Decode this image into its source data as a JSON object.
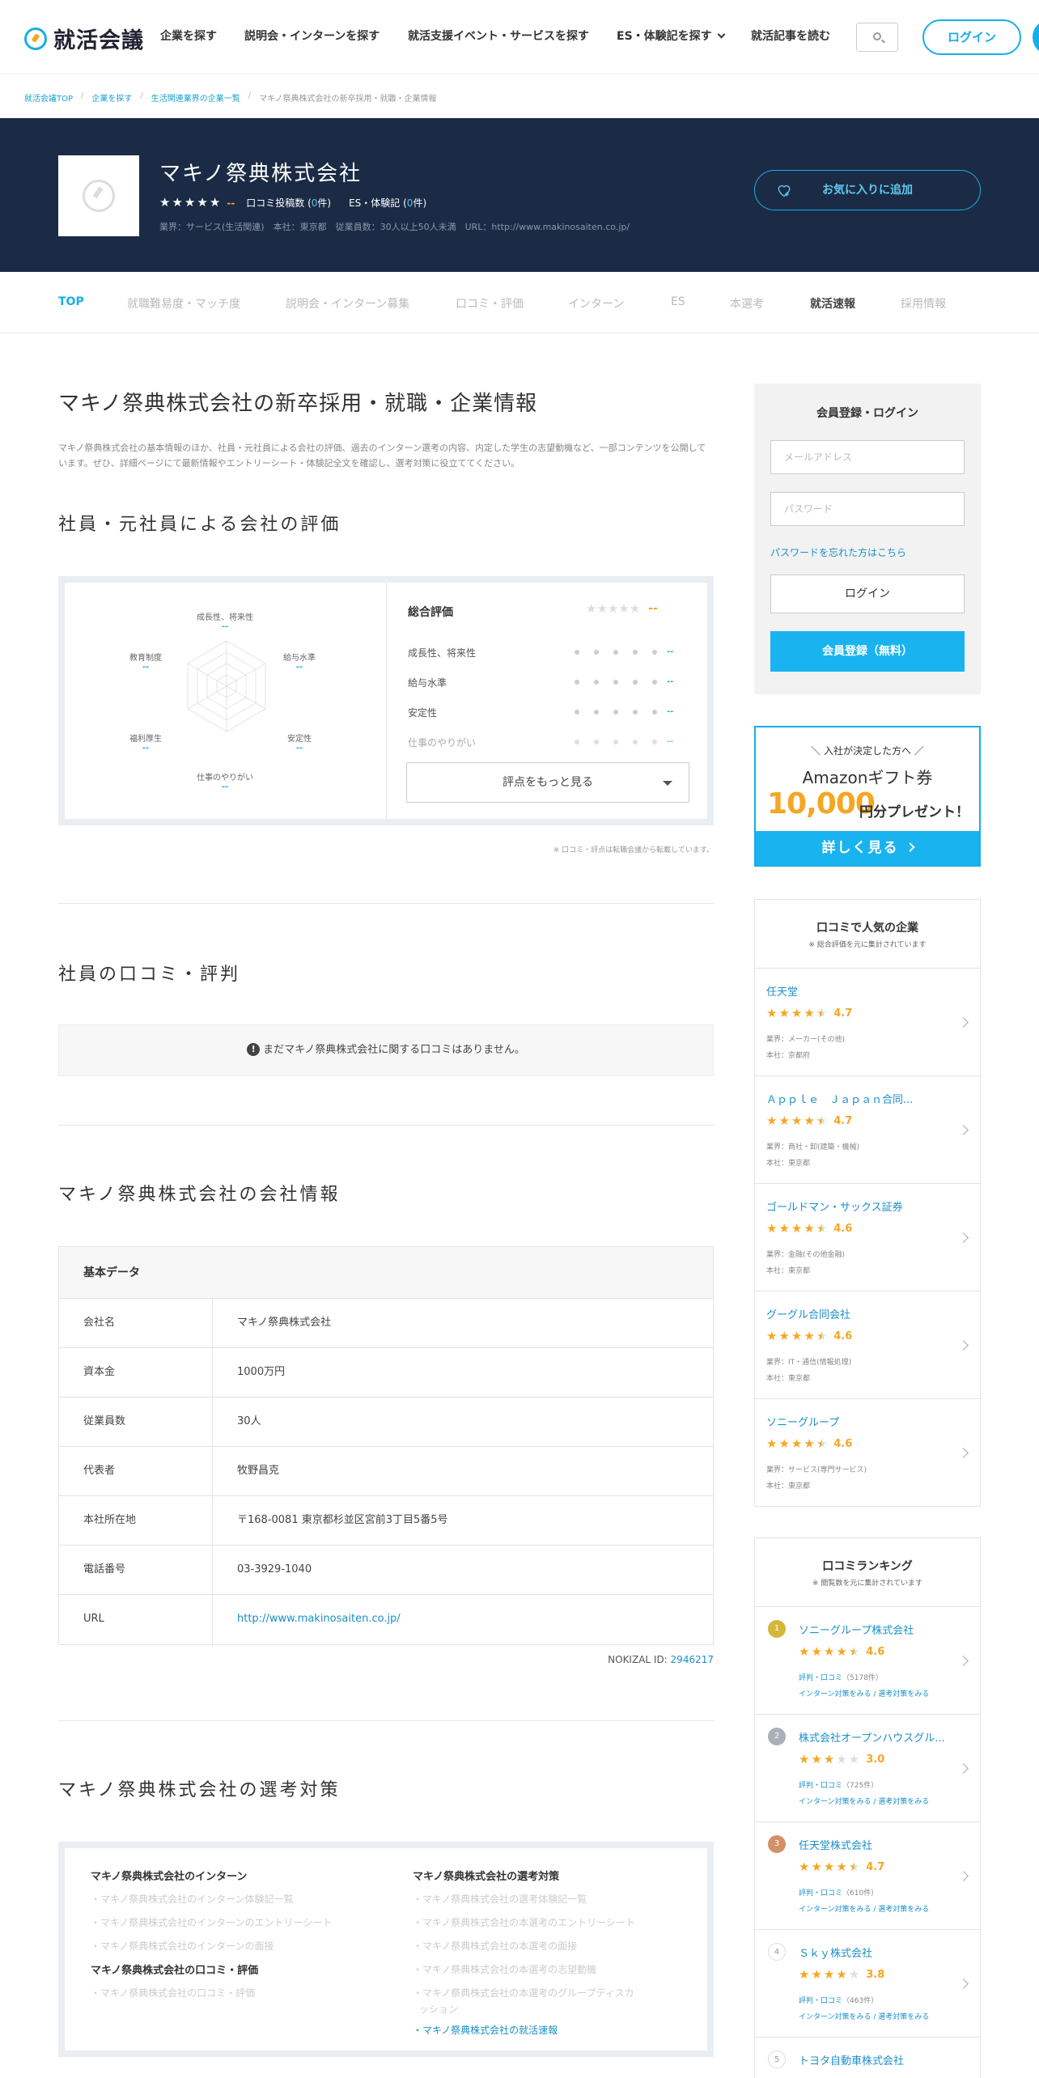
{
  "header": {
    "logo_text": "就活会議",
    "nav": [
      "企業を探す",
      "説明会・インターンを探す",
      "就活支援イベント・サービスを探す",
      "ES・体験記を探す",
      "就活記事を読む"
    ],
    "login": "ログイン"
  },
  "breadcrumb": [
    "就活会議TOP",
    "企業を探す",
    "生活関連業界の企業一覧",
    "マキノ祭典株式会社の新卒採用・就職・企業情報"
  ],
  "company": {
    "name": "マキノ祭典株式会社",
    "rating": "--",
    "reviews_label": "口コミ投稿数",
    "reviews_count": "0",
    "reviews_unit": "件",
    "es_label": "ES・体験記",
    "es_count": "0",
    "meta": "業界：サービス(生活関連)　本社：東京都　従業員数：30人以上50人未満　URL：http://www.makinosaiten.co.jp/",
    "favorite": "お気に入りに追加"
  },
  "tabs": [
    "TOP",
    "就職難易度・マッチ度",
    "説明会・インターン募集",
    "口コミ・評価",
    "インターン",
    "ES",
    "本選考",
    "就活速報",
    "採用情報"
  ],
  "main": {
    "title": "マキノ祭典株式会社の新卒採用・就職・企業情報",
    "intro": "マキノ祭典株式会社の基本情報のほか、社員・元社員による会社の評価、過去のインターン選考の内容、内定した学生の志望動機など、一部コンテンツを公開しています。ぜひ、詳細ページにて最新情報やエントリーシート・体験記全文を確認し、選考対策に役立ててください。",
    "eval_title": "社員・元社員による会社の評価",
    "radar": [
      {
        "label": "成長性、将来性",
        "value": "--"
      },
      {
        "label": "給与水準",
        "value": "--"
      },
      {
        "label": "安定性",
        "value": "--"
      },
      {
        "label": "仕事のやりがい",
        "value": "--"
      },
      {
        "label": "福利厚生",
        "value": "--"
      },
      {
        "label": "教育制度",
        "value": "--"
      }
    ],
    "summary_title": "総合評価",
    "summary_value": "--",
    "criteria": [
      {
        "label": "成長性、将来性",
        "value": "--"
      },
      {
        "label": "給与水準",
        "value": "--"
      },
      {
        "label": "安定性",
        "value": "--"
      },
      {
        "label": "仕事のやりがい",
        "value": "--"
      }
    ],
    "more": "評点をもっと見る",
    "note": "※ 口コミ・評点は転職会議から転載しています。",
    "reviews_title": "社員の口コミ・評判",
    "reviews_empty": "まだマキノ祭典株式会社に関する口コミはありません。",
    "info_title": "マキノ祭典株式会社の会社情報",
    "table_head": "基本データ",
    "table": [
      {
        "k": "会社名",
        "v": "マキノ祭典株式会社"
      },
      {
        "k": "資本金",
        "v": "1000万円"
      },
      {
        "k": "従業員数",
        "v": "30人"
      },
      {
        "k": "代表者",
        "v": "牧野昌克"
      },
      {
        "k": "本社所在地",
        "v": "〒168-0081 東京都杉並区宮前3丁目5番5号"
      },
      {
        "k": "電話番号",
        "v": "03-3929-1040"
      },
      {
        "k": "URL",
        "v": "http://www.makinosaiten.co.jp/"
      }
    ],
    "nokizal_label": "NOKIZAL ID: ",
    "nokizal_id": "2946217",
    "sel_title": "マキノ祭典株式会社の選考対策",
    "sel_left": {
      "title1": "マキノ祭典株式会社のインターン",
      "items1": [
        "・マキノ祭典株式会社のインターン体験記一覧",
        "・マキノ祭典株式会社のインターンのエントリーシート",
        "・マキノ祭典株式会社のインターンの面接"
      ],
      "title2": "マキノ祭典株式会社の口コミ・評価",
      "items2": [
        "・マキノ祭典株式会社の口コミ・評価"
      ]
    },
    "sel_right": {
      "title": "マキノ祭典株式会社の選考対策",
      "items": [
        "・マキノ祭典株式会社の選考体験記一覧",
        "・マキノ祭典株式会社の本選考のエントリーシート",
        "・マキノ祭典株式会社の本選考の面接",
        "・マキノ祭典株式会社の本選考の志望動機",
        "・マキノ祭典株式会社の本選考のグループディスカ",
        "ッション"
      ],
      "active": "・マキノ祭典株式会社の就活速報"
    }
  },
  "sidebar": {
    "login_title": "会員登録・ログイン",
    "email_placeholder": "メールアドレス",
    "password_placeholder": "パスワード",
    "forgot": "パスワードを忘れた方はこちら",
    "login": "ログイン",
    "register": "会員登録（無料）",
    "promo": {
      "sub": "＼ 入社が決定した方へ ／",
      "amazon": "Amazonギフト券",
      "big": "10,000",
      "rest": "円分プレゼント！",
      "btn": "詳しく見る"
    },
    "popular_title": "口コミで人気の企業",
    "popular_sub": "※ 総合評価を元に集計されています",
    "popular": [
      {
        "name": "任天堂",
        "rating": "4.7",
        "stars": 4.5,
        "industry": "業界：メーカー(その他)",
        "hq": "本社：京都府"
      },
      {
        "name": "Ａｐｐｌｅ　Ｊａｐａｎ合同...",
        "rating": "4.7",
        "stars": 4.5,
        "industry": "業界：商社・卸(建築・機械)",
        "hq": "本社：東京都"
      },
      {
        "name": "ゴールドマン・サックス証券",
        "rating": "4.6",
        "stars": 4.5,
        "industry": "業界：金融(その他金融)",
        "hq": "本社：東京都"
      },
      {
        "name": "グーグル合同会社",
        "rating": "4.6",
        "stars": 4.5,
        "industry": "業界：IT・通信(情報処理)",
        "hq": "本社：東京都"
      },
      {
        "name": "ソニーグループ",
        "rating": "4.6",
        "stars": 4.5,
        "industry": "業界：サービス(専門サービス)",
        "hq": "本社：東京都"
      }
    ],
    "ranking_title": "口コミランキング",
    "ranking_sub": "※ 閲覧数を元に集計されています",
    "rev_label": "評判・口コミ",
    "links": "インターン対策をみる / 選考対策をみる",
    "ranking": [
      {
        "rank": "1",
        "name": "ソニーグループ株式会社",
        "rating": "4.6",
        "stars": 4.5,
        "reviews": "（5178件）",
        "color": "#d4b63a"
      },
      {
        "rank": "2",
        "name": "株式会社オープンハウスグル...",
        "rating": "3.0",
        "stars": 3,
        "reviews": "（725件）",
        "color": "#a9b0b8"
      },
      {
        "rank": "3",
        "name": "任天堂株式会社",
        "rating": "4.7",
        "stars": 4.5,
        "reviews": "（610件）",
        "color": "#d19067"
      },
      {
        "rank": "4",
        "name": "Ｓｋｙ株式会社",
        "rating": "3.8",
        "stars": 4,
        "reviews": "（463件）",
        "color": "#ffffff"
      },
      {
        "rank": "5",
        "name": "トヨタ自動車株式会社",
        "rating": "",
        "stars": 0,
        "reviews": "",
        "color": "#ffffff"
      }
    ]
  }
}
